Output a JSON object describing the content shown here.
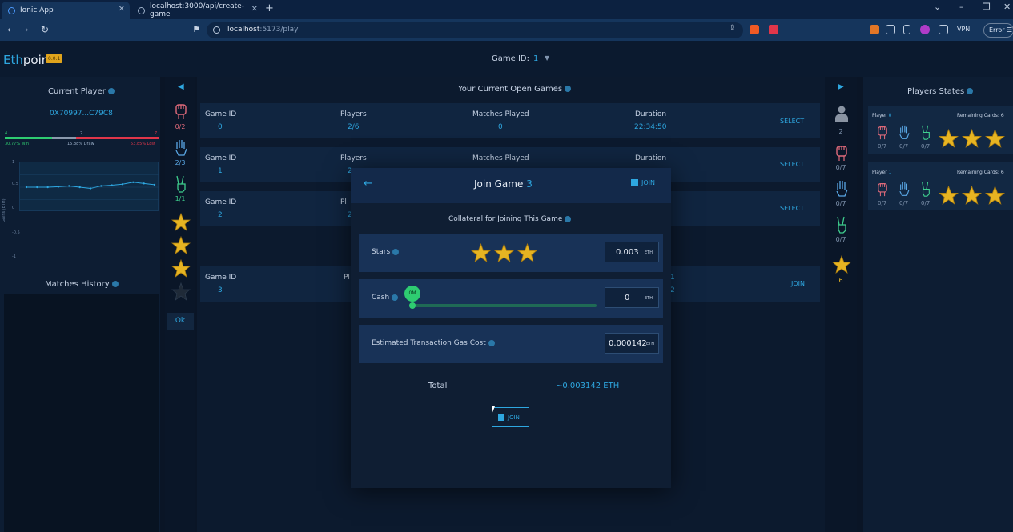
{
  "browser": {
    "tabs": [
      {
        "title": "Ionic App",
        "active": true
      },
      {
        "title": "localhost:3000/api/create-game",
        "active": false
      }
    ],
    "url_host": "localhost",
    "url_rest": ":5173/play",
    "vpn_label": "VPN",
    "error_label": "Error"
  },
  "app": {
    "logo_part1": "Eth",
    "logo_part2": "poir",
    "version": "0.0.1",
    "game_id_label": "Game ID:",
    "game_id_value": "1"
  },
  "left_panel": {
    "title": "Current Player",
    "address": "0X70997...C79C8",
    "wdl_counts": {
      "win": "4",
      "draw": "2",
      "lost": "7"
    },
    "wdl_text": {
      "win": "30.77% Win",
      "draw": "15.38% Draw",
      "lost": "53.85% Lost"
    },
    "chart_ylabel": "Gains (ETH)",
    "chart_yticks": [
      "1",
      "0.5",
      "0",
      "-0.5",
      "-1"
    ],
    "history_title": "Matches History"
  },
  "left_strip": {
    "rock_count": "0/2",
    "paper_count": "2/3",
    "scissors_count": "1/1",
    "stars": [
      true,
      true,
      true,
      false
    ],
    "ok_label": "Ok"
  },
  "center": {
    "title": "Your Current Open Games",
    "col_labels": {
      "game_id": "Game ID",
      "players": "Players",
      "matches": "Matches Played",
      "duration": "Duration"
    },
    "rows": [
      {
        "game_id": "0",
        "players": "2/6",
        "matches": "0",
        "duration": "22:34:50",
        "action": "SELECT"
      },
      {
        "game_id": "1",
        "players": "2",
        "matches": "",
        "duration": "",
        "action": "SELECT"
      },
      {
        "game_id": "2",
        "players": "2",
        "matches": "",
        "duration": "",
        "action": "SELECT"
      },
      {
        "game_id": "3",
        "players": "",
        "matches": "",
        "duration": "2",
        "action": "JOIN"
      }
    ],
    "row_players_label_partial": "Pl",
    "row4_duration_partial": "1"
  },
  "right_strip": {
    "players_count": "2",
    "rock": "0/7",
    "paper": "0/7",
    "scissors": "0/7",
    "stars": "6"
  },
  "right_panel": {
    "title": "Players States",
    "players": [
      {
        "label": "Player",
        "num": "0",
        "remaining_label": "Remaining Cards:",
        "remaining": "6",
        "rock": "0/7",
        "paper": "0/7",
        "scissors": "0/7"
      },
      {
        "label": "Player",
        "num": "1",
        "remaining_label": "Remaining Cards:",
        "remaining": "6",
        "rock": "0/7",
        "paper": "0/7",
        "scissors": "0/7"
      }
    ]
  },
  "modal": {
    "title": "Join Game",
    "game_num": "3",
    "header_join": "JOIN",
    "collateral_title": "Collateral for Joining This Game",
    "stars_label": "Stars",
    "stars_value": "0.003",
    "cash_label": "Cash",
    "cash_value": "0",
    "slider_tip": "0M",
    "gas_label": "Estimated Transaction Gas Cost",
    "gas_value": "0.000142",
    "eth_unit": "ETH",
    "total_label": "Total",
    "total_value": "~0.003142 ETH",
    "join_button": "JOIN"
  },
  "colors": {
    "accent": "#2ea7e0",
    "background": "#0a1526",
    "star": "#e6b422",
    "win": "#2ecc71",
    "lost": "#e0364a"
  },
  "chart_data": {
    "type": "line",
    "x": [
      1,
      2,
      3,
      4,
      5,
      6,
      7,
      8,
      9,
      10,
      11,
      12,
      13
    ],
    "series": [
      {
        "values": [
          0,
          0,
          0,
          0.02,
          0.05,
          0,
          -0.05,
          0.05,
          0.08,
          0.12,
          0.2,
          0.15,
          0.1
        ]
      }
    ],
    "ylabel": "Gains (ETH)",
    "ylim": [
      -1,
      1
    ],
    "yticks": [
      "1",
      "0.5",
      "0",
      "-0.5",
      "-1"
    ],
    "grid": true
  }
}
